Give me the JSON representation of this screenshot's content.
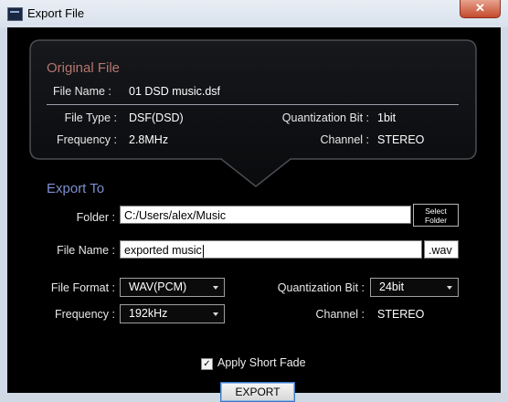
{
  "window": {
    "title": "Export File",
    "close_label": "✕"
  },
  "original_file": {
    "title": "Original File",
    "file_name_label": "File Name :",
    "file_name": "01 DSD music.dsf",
    "file_type_label": "File Type :",
    "file_type": "DSF(DSD)",
    "quant_bit_label": "Quantization Bit :",
    "quant_bit": "1bit",
    "frequency_label": "Frequency :",
    "frequency": "2.8MHz",
    "channel_label": "Channel :",
    "channel": "STEREO"
  },
  "export_to": {
    "title": "Export To",
    "folder_label": "Folder :",
    "folder_value": "C:/Users/alex/Music",
    "select_folder_label_1": "Select",
    "select_folder_label_2": "Folder",
    "file_name_label": "File Name :",
    "file_name_value": "exported music",
    "extension": ".wav",
    "file_format_label": "File Format :",
    "file_format_value": "WAV(PCM)",
    "quant_bit_label": "Quantization Bit :",
    "quant_bit_value": "24bit",
    "frequency_label": "Frequency :",
    "frequency_value": "192kHz",
    "channel_label": "Channel :",
    "channel_value": "STEREO"
  },
  "apply_short_fade": {
    "label": "Apply Short Fade",
    "checked": true,
    "check_glyph": "✓"
  },
  "export_button": {
    "label": "EXPORT"
  },
  "icons": [
    "app-icon",
    "close-icon",
    "chevron-down-icon",
    "checkmark-icon"
  ],
  "colors": {
    "original_title": "#b67570",
    "export_title": "#7d8fd0",
    "background": "#000000",
    "panel_stroke": "#4a4d52"
  }
}
